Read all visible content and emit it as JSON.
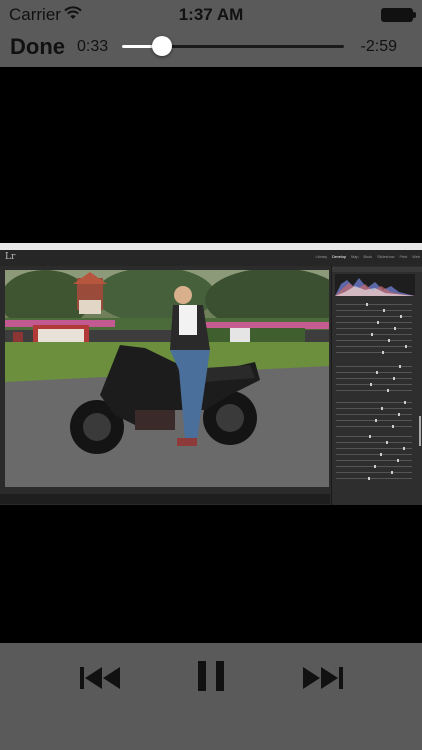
{
  "status_bar": {
    "carrier": "Carrier",
    "time": "1:37 AM",
    "wifi_icon": "wifi-icon",
    "battery_icon": "battery-icon"
  },
  "player": {
    "done_label": "Done",
    "elapsed": "0:33",
    "remaining": "-2:59",
    "progress_fraction": 0.18
  },
  "video": {
    "app_logo": "Lr",
    "modules": [
      "Library",
      "Develop",
      "Map",
      "Book",
      "Slideshow",
      "Print",
      "Web"
    ],
    "active_module": "Develop"
  },
  "controls": {
    "previous_icon": "skip-back-icon",
    "pause_icon": "pause-icon",
    "next_icon": "skip-forward-icon"
  },
  "colors": {
    "chrome": "#5a5a5a",
    "background": "#000000",
    "text": "#111111",
    "thumb": "#ffffff"
  }
}
